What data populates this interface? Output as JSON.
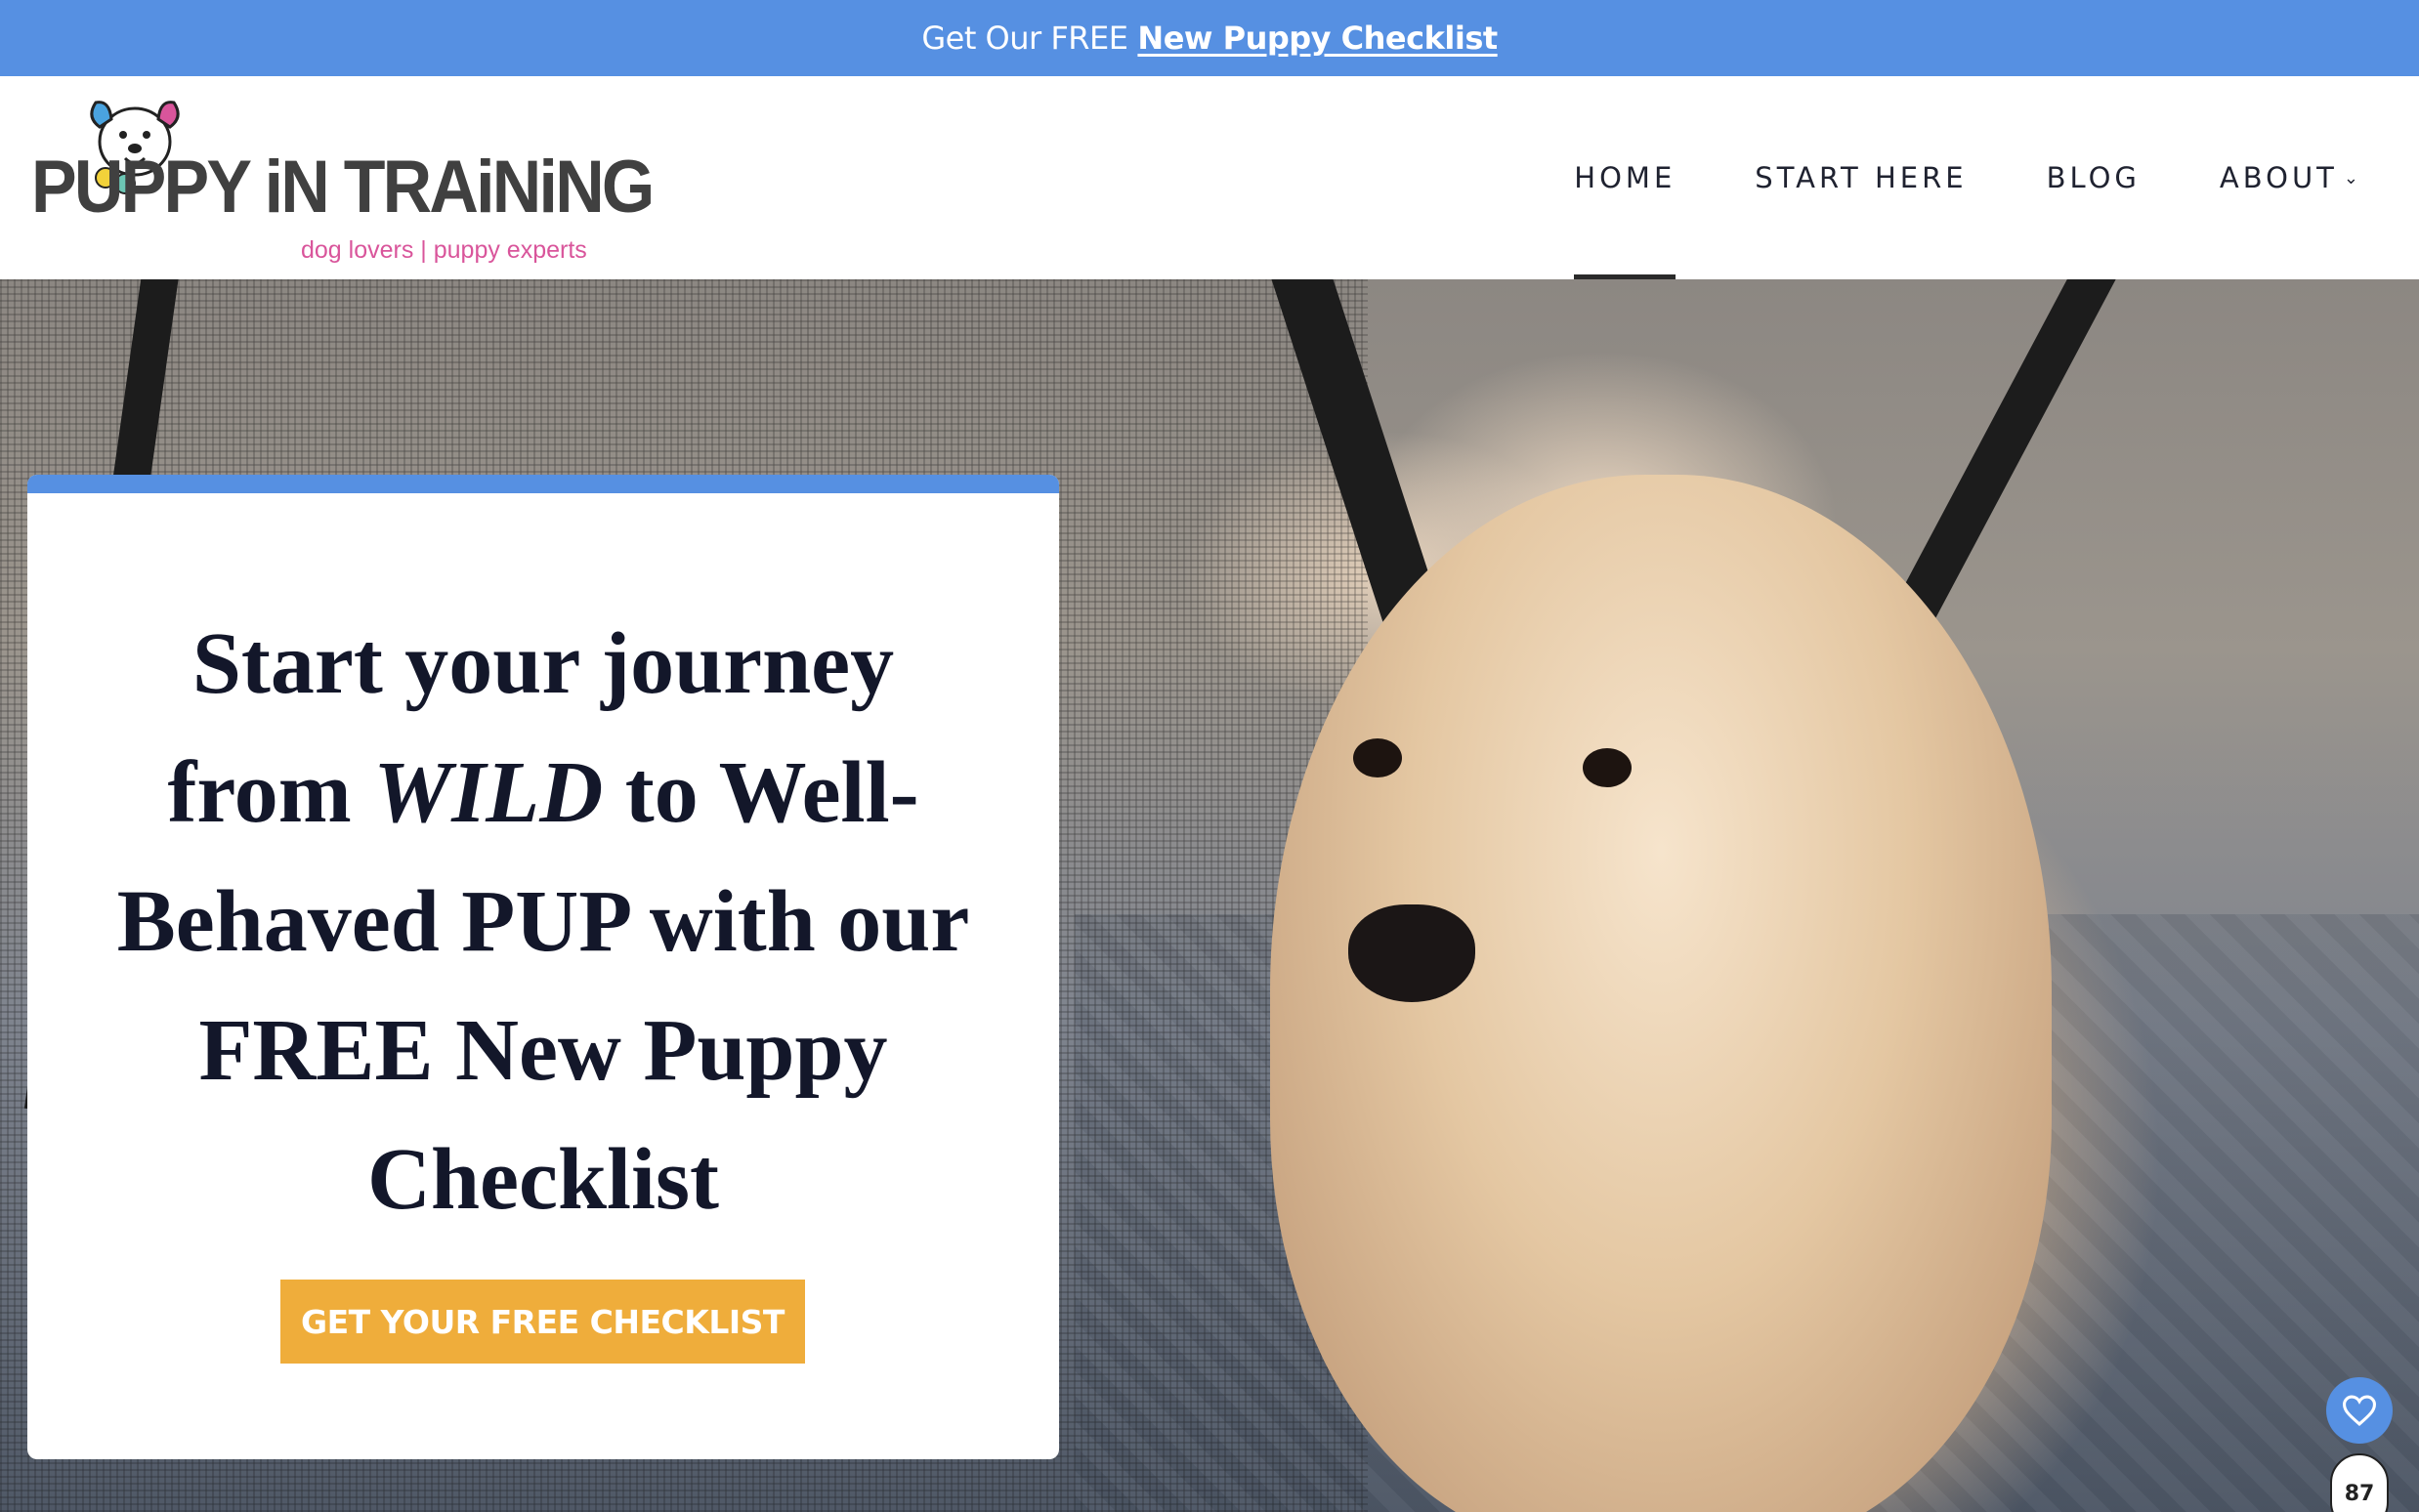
{
  "promo": {
    "lead": "Get Our FREE",
    "link": "New Puppy Checklist"
  },
  "logo": {
    "wordmark": "PUPPY iN TRAiNiNG",
    "tagline": "dog lovers | puppy experts"
  },
  "nav": {
    "items": [
      {
        "label": "HOME",
        "active": true
      },
      {
        "label": "START HERE",
        "active": false
      },
      {
        "label": "BLOG",
        "active": false
      },
      {
        "label": "ABOUT",
        "active": false,
        "has_dropdown": true
      }
    ]
  },
  "hero": {
    "headline": {
      "part1": "Start your journey from",
      "part2_italic": "WILD",
      "part3_bold": "to Well-Behaved PUP",
      "part4": "with our FREE New Puppy Checklist"
    },
    "cta_label": "GET YOUR FREE CHECKLIST",
    "image_alt": "golden retriever puppy in a mesh playpen"
  },
  "widgets": {
    "favorites_icon": "heart-icon",
    "favorites_count": "87"
  },
  "colors": {
    "accent_blue": "#5690e2",
    "cta_orange": "#efad3b",
    "logo_pink": "#d9559b",
    "text_dark": "#13172a"
  }
}
